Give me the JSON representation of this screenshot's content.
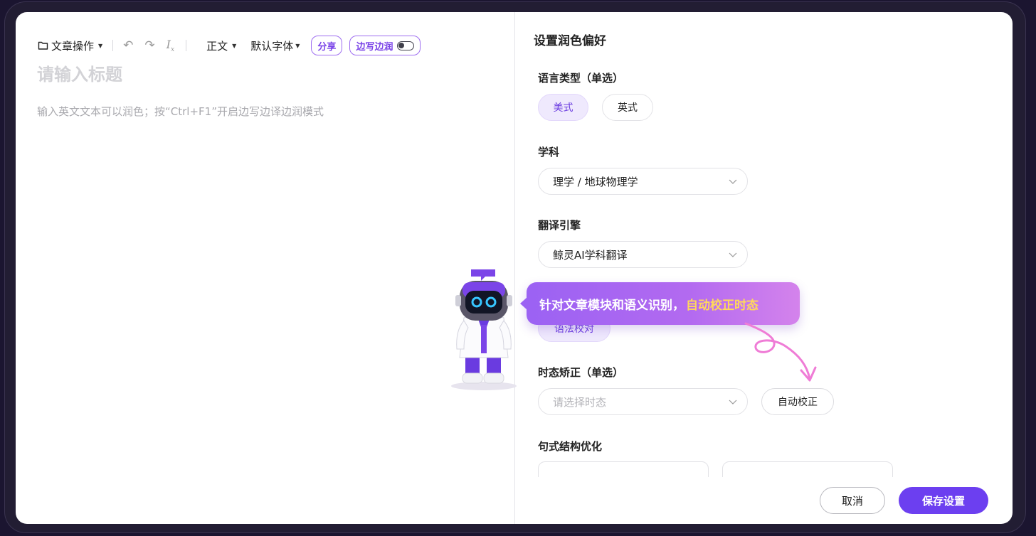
{
  "editor": {
    "toolbar": {
      "doc_ops_label": "文章操作",
      "paragraph_label": "正文",
      "font_label": "默认字体",
      "share_label": "分享",
      "side_label": "边写边润"
    },
    "title_placeholder": "请输入标题",
    "body_hint": "输入英文文本可以润色；按“Ctrl+F1”开启边写边译边润模式"
  },
  "settings": {
    "title": "设置润色偏好",
    "language": {
      "label": "语言类型（单选）",
      "options": [
        "美式",
        "英式"
      ],
      "selected": "美式"
    },
    "subject": {
      "label": "学科",
      "value": "理学 / 地球物理学"
    },
    "engine": {
      "label": "翻译引擎",
      "value": "鲸灵AI学科翻译"
    },
    "grammar_option": "语法校对",
    "tense": {
      "label": "时态矫正（单选）",
      "placeholder": "请选择时态",
      "auto_button": "自动校正"
    },
    "structure": {
      "label": "句式结构优化"
    },
    "footer": {
      "cancel": "取消",
      "save": "保存设置"
    }
  },
  "tooltip": {
    "text": "针对文章模块和语义识别，",
    "highlight": "自动校正时态"
  },
  "colors": {
    "accent": "#6c3ff0",
    "accent_light": "#efe9fd",
    "tooltip_start": "#9b62f3",
    "tooltip_end": "#d483ec",
    "highlight": "#ffd85b",
    "arrow": "#ef7cd6"
  }
}
